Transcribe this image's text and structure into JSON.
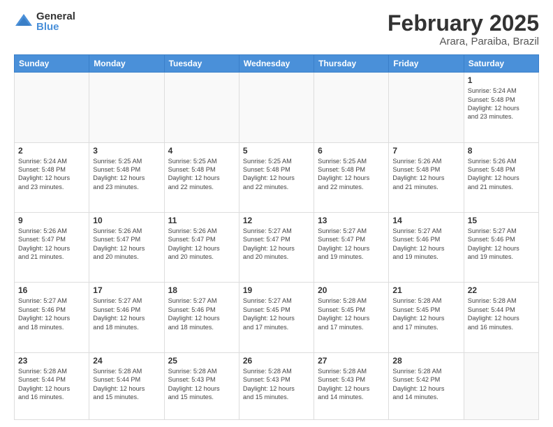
{
  "logo": {
    "general": "General",
    "blue": "Blue"
  },
  "title": "February 2025",
  "subtitle": "Arara, Paraiba, Brazil",
  "days_header": [
    "Sunday",
    "Monday",
    "Tuesday",
    "Wednesday",
    "Thursday",
    "Friday",
    "Saturday"
  ],
  "weeks": [
    [
      {
        "day": "",
        "info": ""
      },
      {
        "day": "",
        "info": ""
      },
      {
        "day": "",
        "info": ""
      },
      {
        "day": "",
        "info": ""
      },
      {
        "day": "",
        "info": ""
      },
      {
        "day": "",
        "info": ""
      },
      {
        "day": "1",
        "info": "Sunrise: 5:24 AM\nSunset: 5:48 PM\nDaylight: 12 hours\nand 23 minutes."
      }
    ],
    [
      {
        "day": "2",
        "info": "Sunrise: 5:24 AM\nSunset: 5:48 PM\nDaylight: 12 hours\nand 23 minutes."
      },
      {
        "day": "3",
        "info": "Sunrise: 5:25 AM\nSunset: 5:48 PM\nDaylight: 12 hours\nand 23 minutes."
      },
      {
        "day": "4",
        "info": "Sunrise: 5:25 AM\nSunset: 5:48 PM\nDaylight: 12 hours\nand 22 minutes."
      },
      {
        "day": "5",
        "info": "Sunrise: 5:25 AM\nSunset: 5:48 PM\nDaylight: 12 hours\nand 22 minutes."
      },
      {
        "day": "6",
        "info": "Sunrise: 5:25 AM\nSunset: 5:48 PM\nDaylight: 12 hours\nand 22 minutes."
      },
      {
        "day": "7",
        "info": "Sunrise: 5:26 AM\nSunset: 5:48 PM\nDaylight: 12 hours\nand 21 minutes."
      },
      {
        "day": "8",
        "info": "Sunrise: 5:26 AM\nSunset: 5:48 PM\nDaylight: 12 hours\nand 21 minutes."
      }
    ],
    [
      {
        "day": "9",
        "info": "Sunrise: 5:26 AM\nSunset: 5:47 PM\nDaylight: 12 hours\nand 21 minutes."
      },
      {
        "day": "10",
        "info": "Sunrise: 5:26 AM\nSunset: 5:47 PM\nDaylight: 12 hours\nand 20 minutes."
      },
      {
        "day": "11",
        "info": "Sunrise: 5:26 AM\nSunset: 5:47 PM\nDaylight: 12 hours\nand 20 minutes."
      },
      {
        "day": "12",
        "info": "Sunrise: 5:27 AM\nSunset: 5:47 PM\nDaylight: 12 hours\nand 20 minutes."
      },
      {
        "day": "13",
        "info": "Sunrise: 5:27 AM\nSunset: 5:47 PM\nDaylight: 12 hours\nand 19 minutes."
      },
      {
        "day": "14",
        "info": "Sunrise: 5:27 AM\nSunset: 5:46 PM\nDaylight: 12 hours\nand 19 minutes."
      },
      {
        "day": "15",
        "info": "Sunrise: 5:27 AM\nSunset: 5:46 PM\nDaylight: 12 hours\nand 19 minutes."
      }
    ],
    [
      {
        "day": "16",
        "info": "Sunrise: 5:27 AM\nSunset: 5:46 PM\nDaylight: 12 hours\nand 18 minutes."
      },
      {
        "day": "17",
        "info": "Sunrise: 5:27 AM\nSunset: 5:46 PM\nDaylight: 12 hours\nand 18 minutes."
      },
      {
        "day": "18",
        "info": "Sunrise: 5:27 AM\nSunset: 5:46 PM\nDaylight: 12 hours\nand 18 minutes."
      },
      {
        "day": "19",
        "info": "Sunrise: 5:27 AM\nSunset: 5:45 PM\nDaylight: 12 hours\nand 17 minutes."
      },
      {
        "day": "20",
        "info": "Sunrise: 5:28 AM\nSunset: 5:45 PM\nDaylight: 12 hours\nand 17 minutes."
      },
      {
        "day": "21",
        "info": "Sunrise: 5:28 AM\nSunset: 5:45 PM\nDaylight: 12 hours\nand 17 minutes."
      },
      {
        "day": "22",
        "info": "Sunrise: 5:28 AM\nSunset: 5:44 PM\nDaylight: 12 hours\nand 16 minutes."
      }
    ],
    [
      {
        "day": "23",
        "info": "Sunrise: 5:28 AM\nSunset: 5:44 PM\nDaylight: 12 hours\nand 16 minutes."
      },
      {
        "day": "24",
        "info": "Sunrise: 5:28 AM\nSunset: 5:44 PM\nDaylight: 12 hours\nand 15 minutes."
      },
      {
        "day": "25",
        "info": "Sunrise: 5:28 AM\nSunset: 5:43 PM\nDaylight: 12 hours\nand 15 minutes."
      },
      {
        "day": "26",
        "info": "Sunrise: 5:28 AM\nSunset: 5:43 PM\nDaylight: 12 hours\nand 15 minutes."
      },
      {
        "day": "27",
        "info": "Sunrise: 5:28 AM\nSunset: 5:43 PM\nDaylight: 12 hours\nand 14 minutes."
      },
      {
        "day": "28",
        "info": "Sunrise: 5:28 AM\nSunset: 5:42 PM\nDaylight: 12 hours\nand 14 minutes."
      },
      {
        "day": "",
        "info": ""
      }
    ]
  ]
}
